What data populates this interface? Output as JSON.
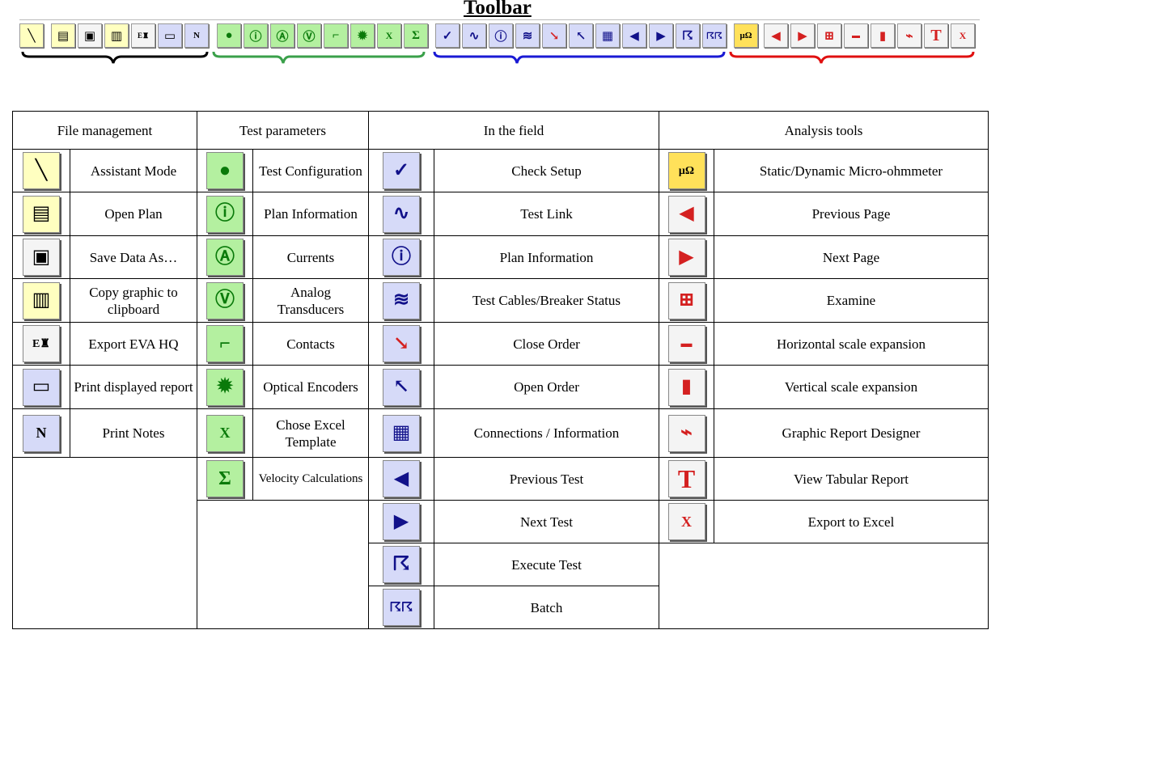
{
  "title": "Toolbar",
  "colors": {
    "file": "#000000",
    "test": "#3aa04a",
    "field": "#1a1ad4",
    "analysis": "#e01010"
  },
  "toolbar": {
    "groups": [
      {
        "name": "file",
        "icons": [
          "wand-icon",
          "open-plan-icon",
          "save-icon",
          "clipboard-icon",
          "eva-icon",
          "print-icon",
          "print-notes-icon"
        ]
      },
      {
        "name": "test",
        "icons": [
          "test-config-icon",
          "info-icon",
          "currents-icon",
          "voltage-icon",
          "contacts-icon",
          "gear-icon",
          "excel-icon",
          "sigma-icon"
        ]
      },
      {
        "name": "field",
        "icons": [
          "check-icon",
          "link-icon",
          "info-icon",
          "cables-icon",
          "close-order-icon",
          "open-order-icon",
          "connections-icon",
          "prev-arrow-icon",
          "next-arrow-icon",
          "run-icon",
          "batch-icon"
        ]
      },
      {
        "name": "analysis",
        "icons": [
          "ohmmeter-icon",
          "prev-page-icon",
          "next-page-icon",
          "examine-icon",
          "h-scale-icon",
          "v-scale-icon",
          "report-designer-icon",
          "text-t-icon",
          "export-excel-icon"
        ]
      }
    ]
  },
  "headers": {
    "file": "File management",
    "test": "Test parameters",
    "field": "In the field",
    "analysis": "Analysis tools"
  },
  "file_items": [
    {
      "label": "Assistant Mode",
      "icon": "wand-icon"
    },
    {
      "label": "Open Plan",
      "icon": "open-plan-icon"
    },
    {
      "label": "Save Data As…",
      "icon": "save-icon"
    },
    {
      "label": "Copy graphic to clipboard",
      "icon": "clipboard-icon"
    },
    {
      "label": "Export EVA HQ",
      "icon": "eva-icon"
    },
    {
      "label": "Print displayed report",
      "icon": "print-icon"
    },
    {
      "label": "Print Notes",
      "icon": "print-notes-icon"
    }
  ],
  "test_items": [
    {
      "label": "Test Configuration",
      "icon": "test-config-icon"
    },
    {
      "label": "Plan Information",
      "icon": "info-icon"
    },
    {
      "label": "Currents",
      "icon": "currents-icon"
    },
    {
      "label": "Analog Transducers",
      "icon": "voltage-icon"
    },
    {
      "label": "Contacts",
      "icon": "contacts-icon"
    },
    {
      "label": "Optical Encoders",
      "icon": "gear-icon"
    },
    {
      "label": "Chose Excel Template",
      "icon": "excel-icon"
    },
    {
      "label": "Velocity Calculations",
      "icon": "sigma-icon"
    }
  ],
  "field_items": [
    {
      "label": "Check Setup",
      "icon": "check-icon"
    },
    {
      "label": "Test Link",
      "icon": "link-icon"
    },
    {
      "label": "Plan Information",
      "icon": "info-icon"
    },
    {
      "label": "Test Cables/Breaker Status",
      "icon": "cables-icon"
    },
    {
      "label": "Close Order",
      "icon": "close-order-icon"
    },
    {
      "label": "Open Order",
      "icon": "open-order-icon"
    },
    {
      "label": "Connections / Information",
      "icon": "connections-icon"
    },
    {
      "label": "Previous Test",
      "icon": "prev-arrow-icon"
    },
    {
      "label": "Next Test",
      "icon": "next-arrow-icon"
    },
    {
      "label": "Execute Test",
      "icon": "run-icon"
    },
    {
      "label": "Batch",
      "icon": "batch-icon"
    }
  ],
  "analysis_items": [
    {
      "label": "Static/Dynamic Micro-ohmmeter",
      "icon": "ohmmeter-icon"
    },
    {
      "label": "Previous Page",
      "icon": "prev-page-icon"
    },
    {
      "label": "Next Page",
      "icon": "next-page-icon"
    },
    {
      "label": "Examine",
      "icon": "examine-icon"
    },
    {
      "label": "Horizontal scale expansion",
      "icon": "h-scale-icon"
    },
    {
      "label": "Vertical scale expansion",
      "icon": "v-scale-icon"
    },
    {
      "label": "Graphic Report Designer",
      "icon": "report-designer-icon"
    },
    {
      "label": "View Tabular Report",
      "icon": "text-t-icon"
    },
    {
      "label": "Export to Excel",
      "icon": "export-excel-icon"
    }
  ]
}
